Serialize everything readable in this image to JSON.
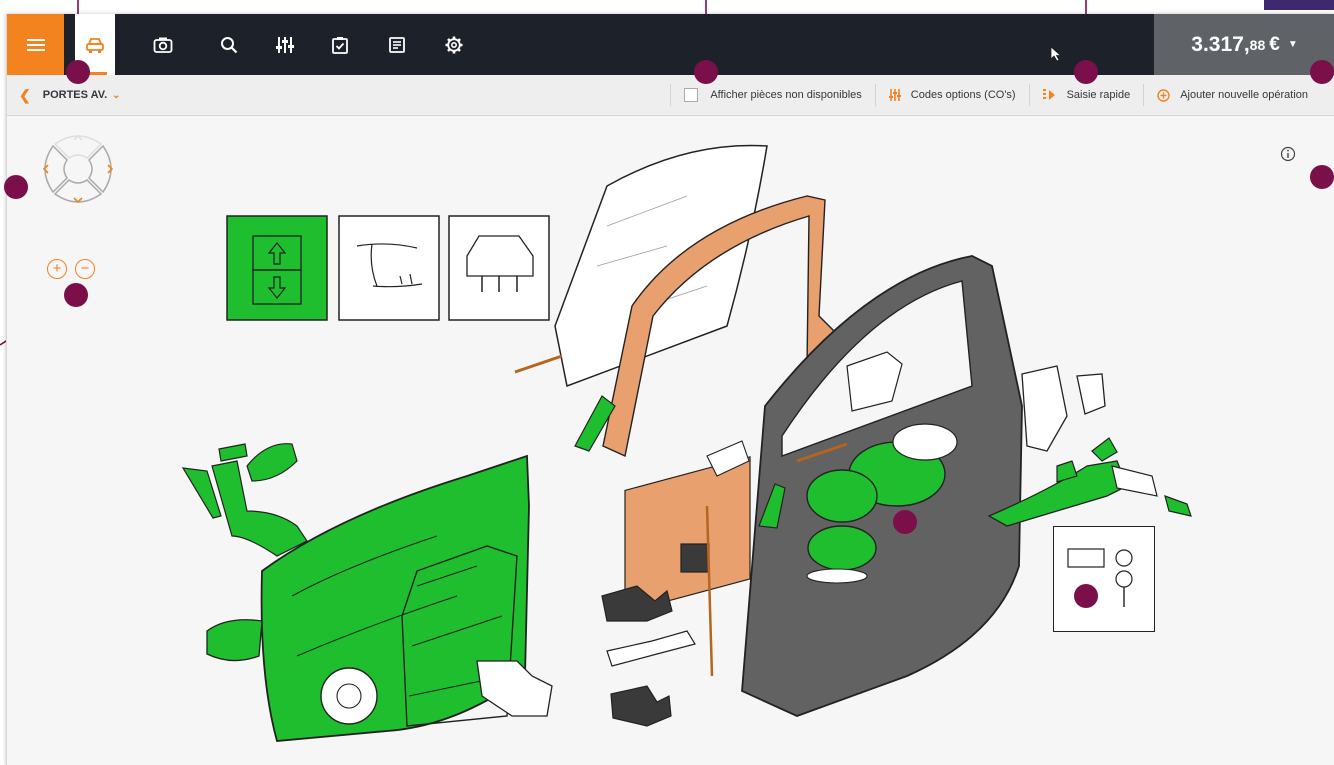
{
  "topbar": {
    "menu_icon": "hamburger-icon",
    "tools": [
      "car-icon",
      "camera-icon",
      "search-icon",
      "sliders-icon",
      "checklist-icon",
      "receipt-icon",
      "gear-icon"
    ],
    "total": {
      "main": "3.317,",
      "cents": "88",
      "currency": "€"
    }
  },
  "subbar": {
    "breadcrumb": "PORTES AV.",
    "show_unavailable": "Afficher pièces non disponibles",
    "option_codes": "Codes options (CO's)",
    "quick_entry": "Saisie rapide",
    "add_operation": "Ajouter nouvelle opération"
  },
  "colors": {
    "accent": "#f2831f",
    "topbar": "#1d2129",
    "total_bg": "#5f6368",
    "selected_part": "#1fbe2f",
    "door_shell": "#626262",
    "seal": "#e8a06e",
    "callout": "#7a0f4a"
  }
}
